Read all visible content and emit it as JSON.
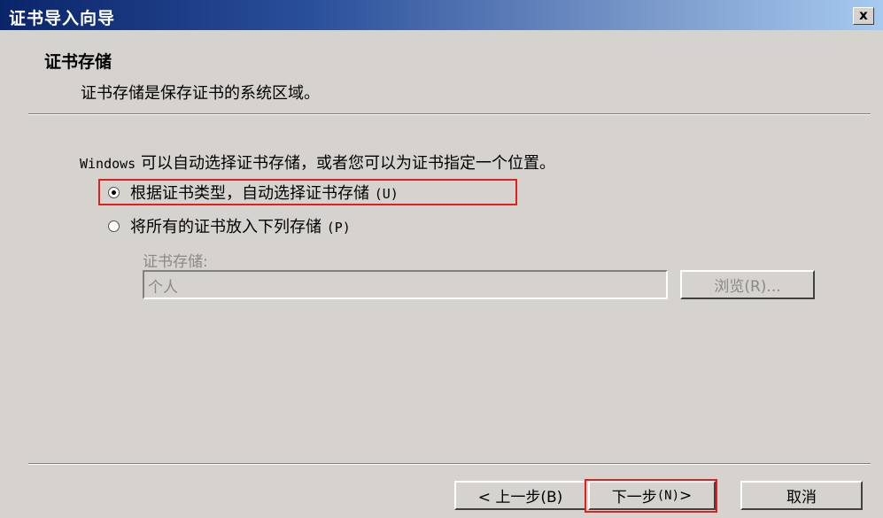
{
  "window": {
    "title": "证书导入向导",
    "close_glyph": "x"
  },
  "header": {
    "title": "证书存储",
    "description": "证书存储是保存证书的系统区域。"
  },
  "content": {
    "intro_prefix": "Windows",
    "intro_text": " 可以自动选择证书存储，或者您可以为证书指定一个位置。",
    "option_auto": {
      "label": "根据证书类型，自动选择证书存储",
      "accelerator": "(U)",
      "selected": true
    },
    "option_manual": {
      "label": "将所有的证书放入下列存储",
      "accelerator": "(P)",
      "selected": false
    },
    "store_label": "证书存储:",
    "store_value": "个人",
    "browse_button": "浏览(R)..."
  },
  "footer": {
    "back_button": "< 上一步(B)",
    "next_label": "下一步",
    "next_accelerator": "(N)",
    "next_suffix": " >",
    "cancel_button": "取消"
  },
  "colors": {
    "dialog_bg": "#d6d3ce",
    "title_gradient_start": "#0a246a",
    "title_gradient_end": "#a6caf0",
    "highlight": "#e02020",
    "disabled_text": "#8a8a8a"
  }
}
